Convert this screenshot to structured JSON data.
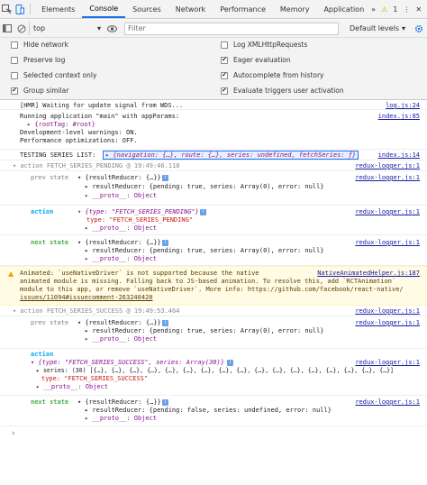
{
  "tabs": {
    "items": [
      "Elements",
      "Console",
      "Sources",
      "Network",
      "Performance",
      "Memory",
      "Application"
    ],
    "more": "»",
    "warn_count": "1"
  },
  "toolbar": {
    "context": "top",
    "filter_placeholder": "Filter",
    "levels": "Default levels"
  },
  "settings": {
    "left": [
      {
        "label": "Hide network",
        "checked": false
      },
      {
        "label": "Preserve log",
        "checked": false
      },
      {
        "label": "Selected context only",
        "checked": false
      },
      {
        "label": "Group similar",
        "checked": true
      }
    ],
    "right": [
      {
        "label": "Log XMLHttpRequests",
        "checked": false
      },
      {
        "label": "Eager evaluation",
        "checked": true
      },
      {
        "label": "Autocomplete from history",
        "checked": true
      },
      {
        "label": "Evaluate triggers user activation",
        "checked": true
      }
    ]
  },
  "log": {
    "hmr": {
      "text": "[HMR] Waiting for update signal from WDS...",
      "src": "log.js:24"
    },
    "running": {
      "l1": "Running application \"main\" with appParams:",
      "l2": "▸ {rootTag: #root}",
      "l3": "Development-level warnings: ON.",
      "l4": "Performance optimizations: OFF.",
      "src": "index.js:85"
    },
    "testing": {
      "label": "TESTING SERIES LIST:",
      "obj": "▸ {navigation: {…}, route: {…}, series: undefined, fetchSeries: ƒ}",
      "src": "index.js:14"
    },
    "group1": {
      "header": "▾ action FETCH_SERIES_PENDING @ 19:49:46.118",
      "src": "redux-logger.js:1",
      "prev_label": "prev state",
      "prev_obj": "▾ {resultReducer: {…}}",
      "prev_child": "▸ resultReducer: {pending: true, series: Array(0), error: null}",
      "prev_proto": "▸ __proto__: Object",
      "prev_src": "redux-logger.js:1",
      "action_label": "action",
      "action_obj": "▾ {type: \"FETCH_SERIES_PENDING\"}",
      "action_type": "type: \"FETCH_SERIES_PENDING\"",
      "action_proto": "▸ __proto__: Object",
      "action_src": "redux-logger.js:1",
      "next_label": "next state",
      "next_obj": "▾ {resultReducer: {…}}",
      "next_child": "▸ resultReducer: {pending: true, series: Array(0), error: null}",
      "next_proto": "▸ __proto__: Object",
      "next_src": "redux-logger.js:1"
    },
    "warning": {
      "l1": "Animated: `useNativeDriver` is not supported because the native",
      "l2": "animated module is missing. Falling back to JS-based animation. To resolve this, add `RCTAnimation`",
      "l3": "module to this app, or remove `useNativeDriver`. More info: https://github.com/facebook/react-native/",
      "l4": "issues/11094#issuecomment-263240420",
      "src": "NativeAnimatedHelper.js:187"
    },
    "group2": {
      "header": "▾ action FETCH_SERIES_SUCCESS @ 19:49:53.464",
      "src": "redux-logger.js:1",
      "prev_label": "prev state",
      "prev_obj": "▾ {resultReducer: {…}}",
      "prev_child": "▸ resultReducer: {pending: true, series: Array(0), error: null}",
      "prev_proto": "▸ __proto__: Object",
      "prev_src": "redux-logger.js:1",
      "action_label": "action",
      "action_obj": "▾ {type: \"FETCH_SERIES_SUCCESS\", series: Array(30)}",
      "action_series": "▸ series: (30) [{…}, {…}, {…}, {…}, {…}, {…}, {…}, {…}, {…}, {…}, {…}, {…}, {…}, {…}, {…}, {…}, {…}]",
      "action_type": "type: \"FETCH_SERIES_SUCCESS\"",
      "action_proto": "▸ __proto__: Object",
      "action_src": "redux-logger.js:1",
      "next_label": "next state",
      "next_obj": "▾ {resultReducer: {…}}",
      "next_child": "▸ resultReducer: {pending: false, series: undefined, error: null}",
      "next_proto": "▸ __proto__: Object",
      "next_src": "redux-logger.js:1"
    },
    "prompt": "›"
  }
}
